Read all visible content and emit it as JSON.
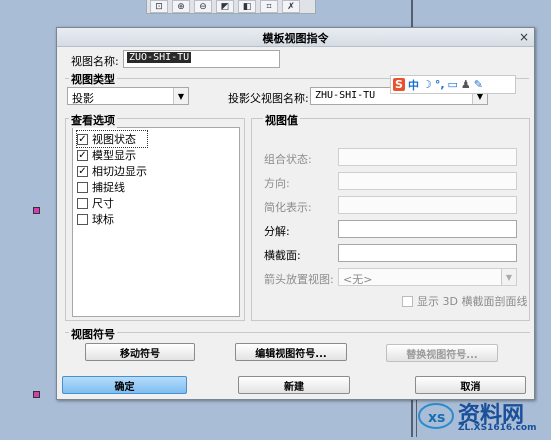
{
  "dialog": {
    "title": "模板视图指令",
    "close_glyph": "×",
    "view_name_label": "视图名称:",
    "view_name_value": "ZUO-SHI-TU",
    "view_type": {
      "section": "视图类型",
      "type_value": "投影",
      "parent_label": "投影父视图名称:",
      "parent_value": "ZHU-SHI-TU"
    },
    "options": {
      "section": "查看选项",
      "items": [
        {
          "label": "视图状态",
          "checked": true
        },
        {
          "label": "模型显示",
          "checked": true
        },
        {
          "label": "相切边显示",
          "checked": true
        },
        {
          "label": "捕捉线",
          "checked": false
        },
        {
          "label": "尺寸",
          "checked": false
        },
        {
          "label": "球标",
          "checked": false
        }
      ]
    },
    "values": {
      "section": "视图值",
      "combo_state": "组合状态:",
      "orientation": "方向:",
      "simplified": "简化表示:",
      "explode": "分解:",
      "cross_section": "横截面:",
      "arrow_view": "箭头放置视图:",
      "arrow_view_value": "<无>",
      "show3d_label": "显示 3D 横截面剖面线"
    },
    "symbol": {
      "section": "视图符号",
      "move": "移动符号",
      "edit": "编辑视图符号...",
      "replace": "替换视图符号..."
    },
    "footer": {
      "ok": "确定",
      "new": "新建",
      "cancel": "取消"
    }
  },
  "ime": {
    "logo": "S",
    "mode": "中",
    "items": [
      "moon-icon",
      "punctuation-icon",
      "keyboard-icon",
      "skin-icon",
      "wrench-icon"
    ]
  },
  "toolbar": {
    "icons": [
      "zoom-fit-icon",
      "zoom-in-icon",
      "zoom-out-icon",
      "repaint-icon",
      "orient-icon",
      "saved-views-icon",
      "layer-icon"
    ]
  },
  "watermark": {
    "brand": "资料网",
    "url": "ZL.XS1616.com"
  },
  "colors": {
    "titlebar": "#dde2e9",
    "primary_button": "#8fc6f3",
    "background": "#a9bdd6"
  }
}
